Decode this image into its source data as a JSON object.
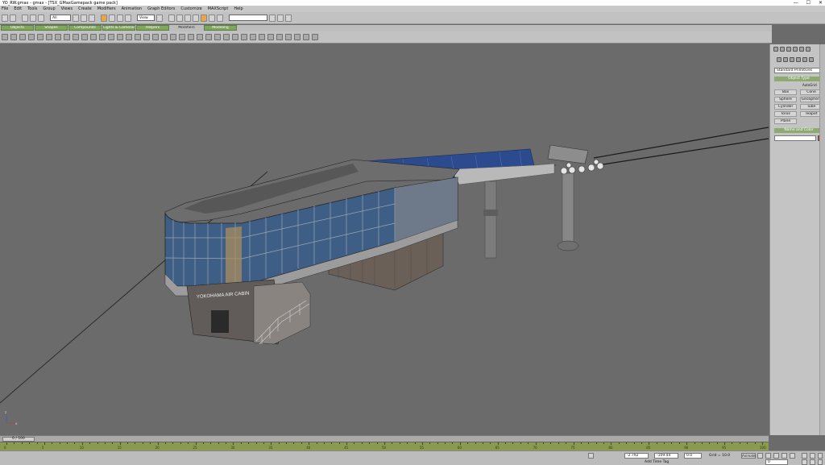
{
  "window": {
    "title": "YO_RW.gmax - gmax - [TSX_GMaxGamepack game pack]",
    "minimize": "—",
    "maximize": "☐",
    "close": "✕"
  },
  "menu": [
    "File",
    "Edit",
    "Tools",
    "Group",
    "Views",
    "Create",
    "Modifiers",
    "Animation",
    "Graph Editors",
    "Customize",
    "MAXScript",
    "Help"
  ],
  "toolbar": {
    "selection_filter": "All",
    "coord_system": "View"
  },
  "tabs": [
    "Objects",
    "Shapes",
    "Compounds",
    "Lights & Cameras",
    "Helpers",
    "Modifiers",
    "Modeling"
  ],
  "active_tab": "Modifiers",
  "viewport": {
    "building_sign": "YOKOHAMA AIR CABIN",
    "axis_x": "x",
    "axis_z": "z"
  },
  "command_panel": {
    "category": "Standard Primitives",
    "object_type_header": "Object Type",
    "autogrid": "AutoGrid",
    "buttons": [
      "Box",
      "Cone",
      "Sphere",
      "GeoSphere",
      "Cylinder",
      "Tube",
      "Torus",
      "Teapot",
      "Plane"
    ],
    "name_color_header": "Name and Color",
    "object_color": "#c0392b"
  },
  "trackbar": {
    "frame_counter": "0 / 100"
  },
  "timeline": {
    "ticks": [
      0,
      5,
      10,
      15,
      20,
      25,
      30,
      35,
      40,
      45,
      50,
      55,
      60,
      65,
      70,
      75,
      80,
      85,
      90,
      95,
      100
    ]
  },
  "status": {
    "x": "-2.792",
    "y": "-109.44",
    "z": "0.0",
    "grid": "Grid = 10.0",
    "animate": "Animate",
    "add_time_tag": "Add Time Tag",
    "frame": "0"
  }
}
